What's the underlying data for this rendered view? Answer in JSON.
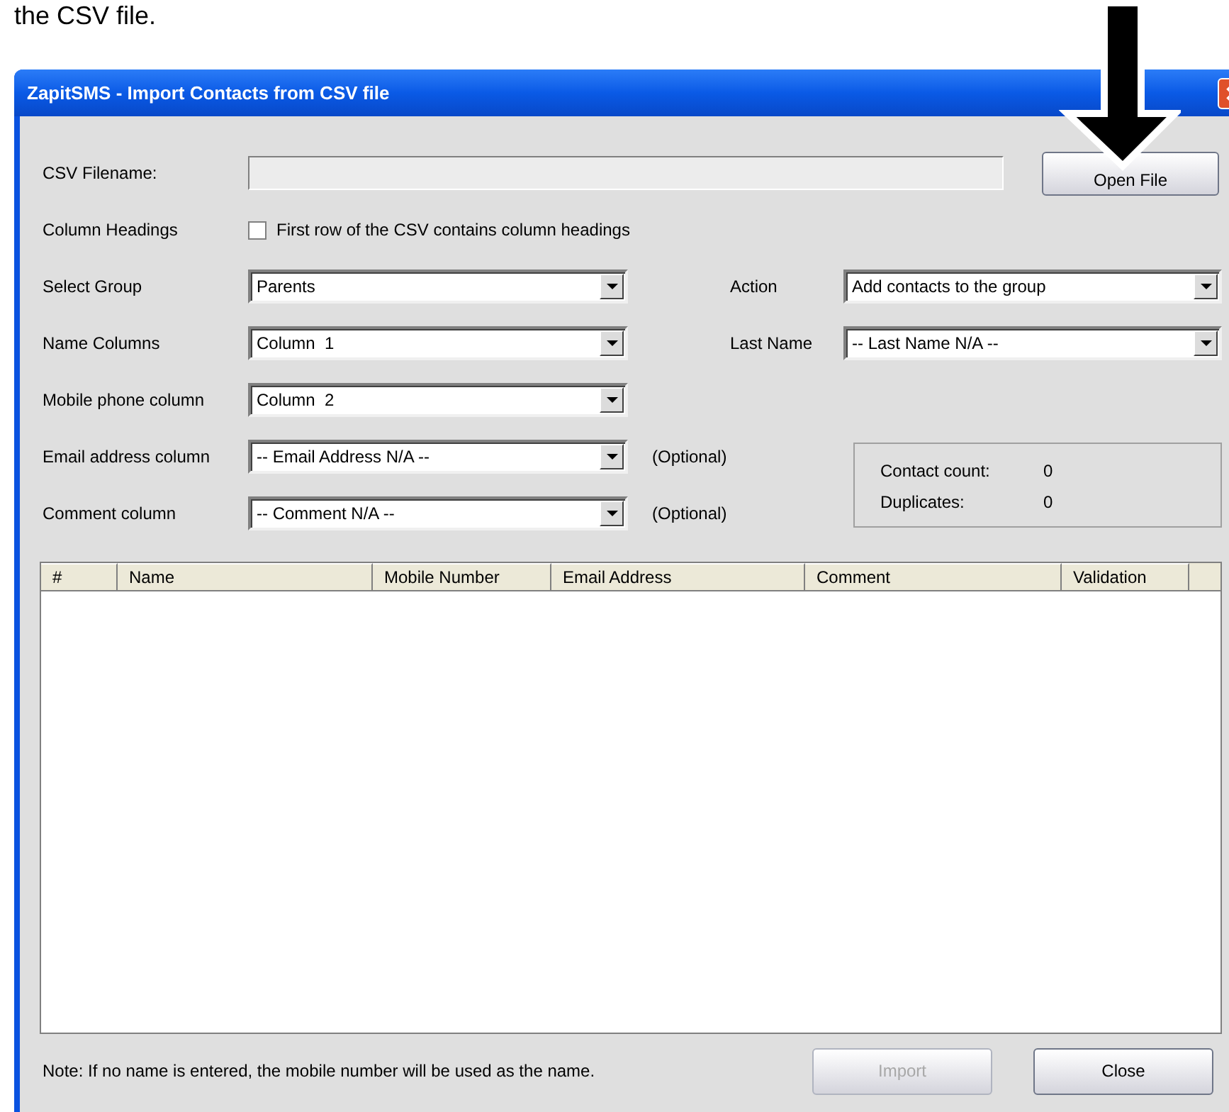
{
  "caption": "the CSV file.",
  "window": {
    "title": "ZapitSMS - Import Contacts from CSV file"
  },
  "csv_filename": {
    "label": "CSV Filename:"
  },
  "open_file_button": "Open File",
  "column_headings": {
    "label": "Column Headings",
    "checkbox_label": "First row of the CSV contains column headings",
    "checked": false
  },
  "left_selects": [
    {
      "label": "Select Group",
      "value": "Parents"
    },
    {
      "label": "Name Columns",
      "value": "Column  1"
    },
    {
      "label": "Mobile phone column",
      "value": "Column  2"
    },
    {
      "label": "Email address column",
      "value": "-- Email Address N/A --",
      "note": "(Optional)"
    },
    {
      "label": "Comment column",
      "value": "-- Comment N/A --",
      "note": "(Optional)"
    }
  ],
  "right_selects": [
    {
      "label": "Action",
      "value": "Add contacts to the group"
    },
    {
      "label": "Last Name",
      "value": "-- Last Name N/A --"
    }
  ],
  "stats": [
    {
      "label": "Contact count:",
      "value": "0"
    },
    {
      "label": "Duplicates:",
      "value": "0"
    }
  ],
  "table": {
    "columns": [
      "#",
      "Name",
      "Mobile Number",
      "Email Address",
      "Comment",
      "Validation"
    ]
  },
  "note": "Note: If no name is entered, the mobile number will be used as the name.",
  "buttons": [
    {
      "label": "Import",
      "disabled": true
    },
    {
      "label": "Close",
      "disabled": false
    }
  ]
}
